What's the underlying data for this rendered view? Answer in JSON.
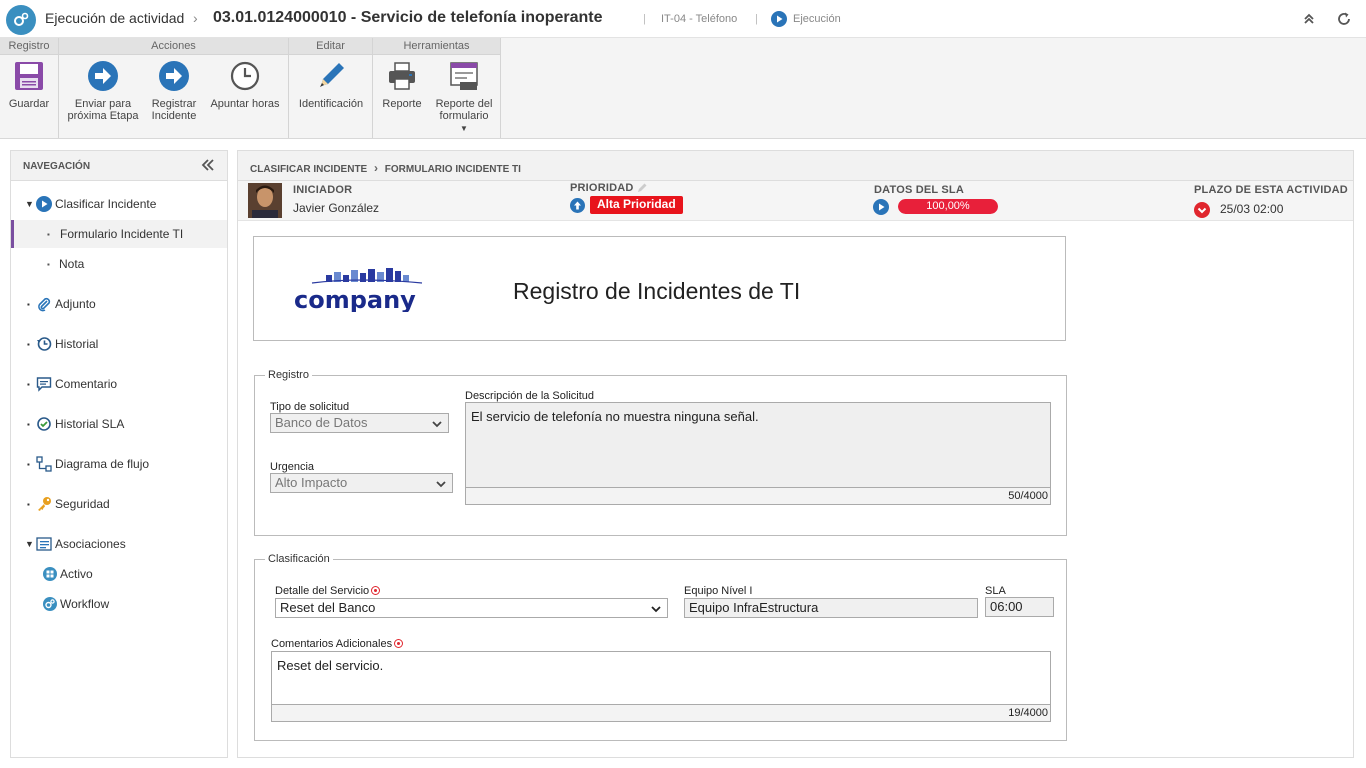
{
  "header": {
    "section": "Ejecución de actividad",
    "record_title": "03.01.0124000010 - Servicio de telefonía inoperante",
    "category": "IT-04 - Teléfono",
    "status": "Ejecución"
  },
  "ribbon": {
    "groups": [
      "Registro",
      "Acciones",
      "Editar",
      "Herramientas"
    ],
    "save": "Guardar",
    "send_next": [
      "Enviar para",
      "próxima Etapa"
    ],
    "register_incident": [
      "Registrar",
      "Incidente"
    ],
    "log_hours": "Apuntar horas",
    "identification": "Identificación",
    "report": "Reporte",
    "form_report": [
      "Reporte del",
      "formulario"
    ]
  },
  "nav": {
    "title": "NAVEGACIÓN",
    "items": {
      "classify": "Clasificar Incidente",
      "form": "Formulario Incidente TI",
      "note": "Nota",
      "attachment": "Adjunto",
      "history": "Historial",
      "comment": "Comentario",
      "sla_history": "Historial SLA",
      "flow": "Diagrama de flujo",
      "security": "Seguridad",
      "associations": "Asociaciones",
      "asset": "Activo",
      "workflow": "Workflow"
    }
  },
  "breadcrumb": {
    "level1": "CLASIFICAR INCIDENTE",
    "level2": "FORMULARIO INCIDENTE TI"
  },
  "info": {
    "initiator_label": "INICIADOR",
    "initiator": "Javier González",
    "priority_label": "PRIORIDAD",
    "priority": "Alta Prioridad",
    "sla_label": "DATOS DEL SLA",
    "sla_progress": "100,00%",
    "sla_progress_value": 100,
    "deadline_label": "PLAZO DE ESTA ACTIVIDAD",
    "deadline": "25/03 02:00"
  },
  "form": {
    "company_logo": "company",
    "title": "Registro de Incidentes de TI",
    "registro": {
      "legend": "Registro",
      "request_type_label": "Tipo de solicitud",
      "request_type": "Banco de Datos",
      "urgency_label": "Urgencia",
      "urgency": "Alto Impacto",
      "description_label": "Descripción de la Solicitud",
      "description": "El servicio de telefonía no muestra ninguna señal.",
      "description_count": "50/4000"
    },
    "clasificacion": {
      "legend": "Clasificación",
      "service_detail_label": "Detalle del Servicio",
      "service_detail": "Reset del Banco",
      "team_label": "Equipo Nível I",
      "team": "Equipo InfraEstructura",
      "sla_label": "SLA",
      "sla": "06:00",
      "comments_label": "Comentarios Adicionales",
      "comments": "Reset del servicio.",
      "comments_count": "19/4000"
    }
  },
  "colors": {
    "accent": "#2a74b8",
    "priority_red": "#e8141c",
    "sla_red": "#e8203a",
    "nav_active": "#7a4fa0"
  }
}
